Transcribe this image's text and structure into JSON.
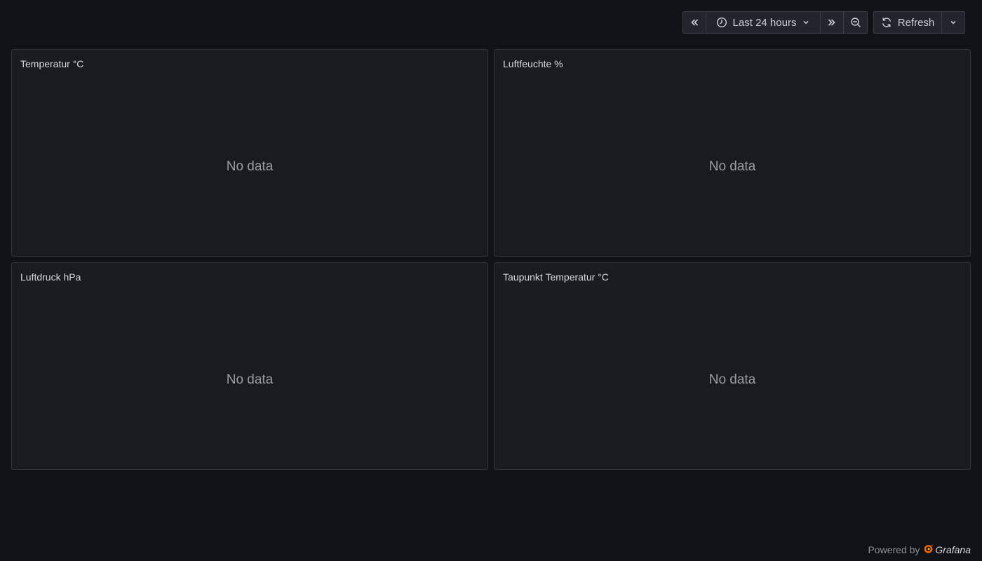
{
  "toolbar": {
    "time_range_label": "Last 24 hours",
    "refresh_label": "Refresh"
  },
  "panels": [
    {
      "title": "Temperatur °C",
      "message": "No data"
    },
    {
      "title": "Luftfeuchte %",
      "message": "No data"
    },
    {
      "title": "Luftdruck hPa",
      "message": "No data"
    },
    {
      "title": "Taupunkt Temperatur °C",
      "message": "No data"
    }
  ],
  "footer": {
    "powered_by": "Powered by",
    "brand": "Grafana"
  },
  "icons": {
    "shift_back": "chevrons-left-icon",
    "clock": "clock-icon",
    "dropdown": "chevron-down-icon",
    "shift_forward": "chevrons-right-icon",
    "zoom_out": "zoom-out-icon",
    "refresh": "sync-icon",
    "brand_logo": "grafana-logo-icon"
  },
  "colors": {
    "background": "#111217",
    "panel": "#181b1f",
    "logo": "#f46800"
  }
}
